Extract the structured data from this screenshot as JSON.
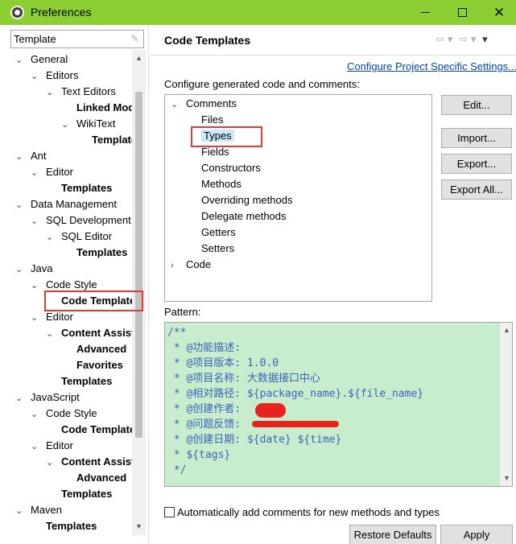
{
  "window": {
    "title": "Preferences"
  },
  "filter": {
    "value": "Template"
  },
  "tree": [
    {
      "label": "General",
      "level": 0,
      "twisty": "open",
      "bold": false
    },
    {
      "label": "Editors",
      "level": 1,
      "twisty": "open",
      "bold": false
    },
    {
      "label": "Text Editors",
      "level": 2,
      "twisty": "open",
      "bold": false
    },
    {
      "label": "Linked Mode",
      "level": 3,
      "twisty": "none",
      "bold": true
    },
    {
      "label": "WikiText",
      "level": 3,
      "twisty": "open",
      "bold": false
    },
    {
      "label": "Templates",
      "level": 4,
      "twisty": "none",
      "bold": true
    },
    {
      "label": "Ant",
      "level": 0,
      "twisty": "open",
      "bold": false
    },
    {
      "label": "Editor",
      "level": 1,
      "twisty": "open",
      "bold": false
    },
    {
      "label": "Templates",
      "level": 2,
      "twisty": "none",
      "bold": true
    },
    {
      "label": "Data Management",
      "level": 0,
      "twisty": "open",
      "bold": false
    },
    {
      "label": "SQL Development",
      "level": 1,
      "twisty": "open",
      "bold": false
    },
    {
      "label": "SQL Editor",
      "level": 2,
      "twisty": "open",
      "bold": false
    },
    {
      "label": "Templates",
      "level": 3,
      "twisty": "none",
      "bold": true
    },
    {
      "label": "Java",
      "level": 0,
      "twisty": "open",
      "bold": false
    },
    {
      "label": "Code Style",
      "level": 1,
      "twisty": "open",
      "bold": false
    },
    {
      "label": "Code Templates",
      "level": 2,
      "twisty": "none",
      "bold": true
    },
    {
      "label": "Editor",
      "level": 1,
      "twisty": "open",
      "bold": false
    },
    {
      "label": "Content Assist",
      "level": 2,
      "twisty": "open",
      "bold": true
    },
    {
      "label": "Advanced",
      "level": 3,
      "twisty": "none",
      "bold": true
    },
    {
      "label": "Favorites",
      "level": 3,
      "twisty": "none",
      "bold": true
    },
    {
      "label": "Templates",
      "level": 2,
      "twisty": "none",
      "bold": true
    },
    {
      "label": "JavaScript",
      "level": 0,
      "twisty": "open",
      "bold": false
    },
    {
      "label": "Code Style",
      "level": 1,
      "twisty": "open",
      "bold": false
    },
    {
      "label": "Code Templates",
      "level": 2,
      "twisty": "none",
      "bold": true
    },
    {
      "label": "Editor",
      "level": 1,
      "twisty": "open",
      "bold": false
    },
    {
      "label": "Content Assist",
      "level": 2,
      "twisty": "open",
      "bold": true
    },
    {
      "label": "Advanced",
      "level": 3,
      "twisty": "none",
      "bold": true
    },
    {
      "label": "Templates",
      "level": 2,
      "twisty": "none",
      "bold": true
    },
    {
      "label": "Maven",
      "level": 0,
      "twisty": "open",
      "bold": false
    },
    {
      "label": "Templates",
      "level": 1,
      "twisty": "none",
      "bold": true
    }
  ],
  "page": {
    "title": "Code Templates",
    "config_link": "Configure Project Specific Settings...",
    "config_label": "Configure generated code and comments:",
    "pattern_label": "Pattern:",
    "checkbox_label": "Automatically add comments for new methods and types",
    "checkbox_checked": false
  },
  "templates_tree": [
    {
      "label": "Comments",
      "level": 0,
      "twisty": "open"
    },
    {
      "label": "Files",
      "level": 1,
      "twisty": "none"
    },
    {
      "label": "Types",
      "level": 1,
      "twisty": "none",
      "selected": true
    },
    {
      "label": "Fields",
      "level": 1,
      "twisty": "none"
    },
    {
      "label": "Constructors",
      "level": 1,
      "twisty": "none"
    },
    {
      "label": "Methods",
      "level": 1,
      "twisty": "none"
    },
    {
      "label": "Overriding methods",
      "level": 1,
      "twisty": "none"
    },
    {
      "label": "Delegate methods",
      "level": 1,
      "twisty": "none"
    },
    {
      "label": "Getters",
      "level": 1,
      "twisty": "none"
    },
    {
      "label": "Setters",
      "level": 1,
      "twisty": "none"
    },
    {
      "label": "Code",
      "level": 0,
      "twisty": "closed"
    }
  ],
  "buttons": {
    "edit": "Edit...",
    "import": "Import...",
    "export": "Export...",
    "export_all": "Export All...",
    "restore_defaults": "Restore Defaults",
    "apply": "Apply"
  },
  "pattern_lines": [
    "/**",
    " * @功能描述:",
    " * @项目版本: 1.0.0",
    " * @项目名称: 大数据接口中心",
    " * @相对路径: ${package_name}.${file_name}",
    " * @创建作者:",
    " * @问题反馈:           .com",
    " * @创建日期: ${date} ${time}",
    " * ${tags}",
    " */"
  ],
  "colors": {
    "titlebar": "#8ccf32",
    "pattern_bg": "#c7edcc",
    "pattern_text": "#3f5fbf",
    "link": "#0645ad",
    "highlight_box": "#e53935"
  }
}
